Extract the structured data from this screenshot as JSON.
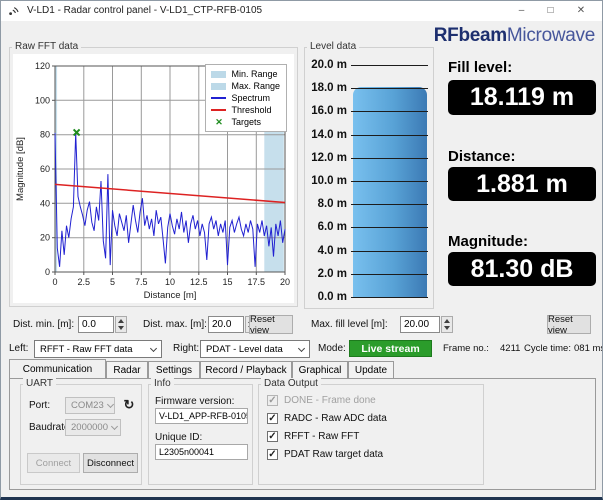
{
  "window": {
    "title": "V-LD1 - Radar control panel - V-LD1_CTP-RFB-0105",
    "minimize": "–",
    "maximize": "□",
    "close": "✕"
  },
  "icons": {
    "refresh": "↻",
    "check": "✓"
  },
  "fft_panel": {
    "group_label": "Raw FFT data",
    "dist_min_label": "Dist. min. [m]:",
    "dist_min_value": "0.0",
    "dist_max_label": "Dist. max. [m]:",
    "dist_max_value": "20.0",
    "reset_label": "Reset view"
  },
  "level_panel": {
    "group_label": "Level data",
    "gauge": {
      "min": 0,
      "max": 20,
      "step": 2,
      "value": 18.119,
      "unit": "m",
      "bar_colors": [
        "#79c0ee",
        "#3c7ab4"
      ],
      "tick_labels": [
        "20.0 m",
        "18.0 m",
        "16.0 m",
        "14.0 m",
        "12.0 m",
        "10.0 m",
        "8.0 m",
        "6.0 m",
        "4.0 m",
        "2.0 m",
        "0.0 m"
      ]
    },
    "max_fill_label": "Max. fill level [m]:",
    "max_fill_value": "20.00",
    "reset_label": "Reset view"
  },
  "readouts": {
    "logo_bold": "RFbeam",
    "logo_light": "Microwave",
    "fill_label": "Fill level:",
    "fill_value": "18.119 m",
    "distance_label": "Distance:",
    "distance_value": "1.881 m",
    "magnitude_label": "Magnitude:",
    "magnitude_value": "81.30 dB"
  },
  "stream_bar": {
    "left_label": "Left:",
    "left_value": "RFFT - Raw FFT data",
    "right_label": "Right:",
    "right_value": "PDAT - Level data",
    "mode_label": "Mode:",
    "mode_value": "Live stream",
    "mode_color": "#2b9c2b",
    "frame_label": "Frame no.:",
    "frame_value": "4211",
    "cycle_label": "Cycle time:",
    "cycle_value": "081 ms"
  },
  "tabs": [
    "Communication",
    "Radar",
    "Settings",
    "Record / Playback",
    "Graphical",
    "Update"
  ],
  "communication_tab": {
    "uart": {
      "label": "UART",
      "port_label": "Port:",
      "port_value": "COM23",
      "baud_label": "Baudrate:",
      "baud_value": "2000000",
      "connect_label": "Connect",
      "disconnect_label": "Disconnect"
    },
    "info": {
      "label": "Info",
      "firmware_label": "Firmware version:",
      "firmware_value": "V-LD1_APP-RFB-0105",
      "uid_label": "Unique ID:",
      "uid_value": "L2305n00041"
    },
    "data_output": {
      "label": "Data Output",
      "checkboxes": [
        {
          "label": "DONE - Frame done",
          "checked": true,
          "enabled": false
        },
        {
          "label": "RADC - Raw ADC data",
          "checked": true,
          "enabled": true
        },
        {
          "label": "RFFT - Raw FFT",
          "checked": true,
          "enabled": true
        },
        {
          "label": "PDAT  Raw target data",
          "checked": true,
          "enabled": true
        }
      ]
    }
  },
  "chart_data": {
    "type": "line",
    "title": "Raw FFT data",
    "xlabel": "Distance [m]",
    "ylabel": "Magnitude [dB]",
    "xlim": [
      0,
      20
    ],
    "ylim": [
      0,
      120
    ],
    "x_ticks": [
      0,
      2.5,
      5,
      7.5,
      10,
      12.5,
      15,
      17.5,
      20
    ],
    "y_ticks": [
      0,
      20,
      40,
      60,
      80,
      100,
      120
    ],
    "grid": true,
    "legend": [
      "Min. Range",
      "Max. Range",
      "Spectrum",
      "Threshold",
      "Targets"
    ],
    "range_fill": "#c6dfec",
    "ranges": {
      "min_range": [
        0,
        0.18
      ],
      "max_range": [
        18.2,
        19.9
      ]
    },
    "series": [
      {
        "name": "Spectrum",
        "color": "#2121d1",
        "width": 1,
        "x_start": 0,
        "x_step": 0.2,
        "values": [
          81,
          14,
          3,
          24,
          10,
          27,
          20,
          31,
          38,
          81,
          44,
          38,
          33,
          27,
          36,
          41,
          29,
          24,
          38,
          30,
          53,
          18,
          8,
          57,
          4,
          36,
          27,
          21,
          34,
          29,
          24,
          33,
          17,
          28,
          39,
          30,
          23,
          35,
          43,
          27,
          33,
          25,
          31,
          21,
          36,
          28,
          32,
          19,
          5,
          26,
          34,
          27,
          22,
          31,
          25,
          35,
          23,
          30,
          17,
          28,
          33,
          25,
          30,
          21,
          28,
          23,
          7,
          28,
          32,
          25,
          30,
          21,
          28,
          23,
          30,
          4,
          26,
          30,
          23,
          28,
          32,
          25,
          21,
          28,
          23,
          30,
          25,
          3,
          28,
          23,
          30,
          21,
          27,
          15,
          26,
          9,
          28,
          21,
          30,
          17,
          25
        ]
      },
      {
        "name": "Threshold",
        "color": "#dd2222",
        "width": 1.5,
        "points": [
          [
            0,
            51
          ],
          [
            20,
            40.5
          ]
        ]
      }
    ],
    "targets": [
      [
        1.881,
        81.3
      ]
    ],
    "target_color": "#1f8c1f"
  }
}
